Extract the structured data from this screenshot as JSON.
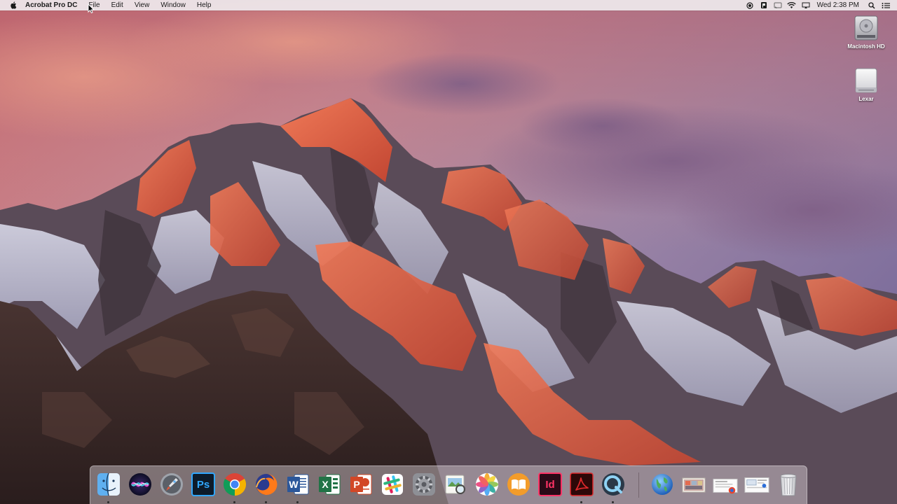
{
  "menubar": {
    "apple_icon": "apple-logo-icon",
    "app_name": "Acrobat Pro DC",
    "menus": [
      "File",
      "Edit",
      "View",
      "Window",
      "Help"
    ],
    "status_icons": [
      "record-icon",
      "flag-icon",
      "cast-icon",
      "wifi-icon",
      "airplay-icon"
    ],
    "clock": "Wed 2:38 PM",
    "search_icon": "spotlight-search-icon",
    "list_icon": "notification-center-icon"
  },
  "desktop": {
    "icons": [
      {
        "label": "Macintosh HD",
        "icon": "hard-drive-icon"
      },
      {
        "label": "Lexar",
        "icon": "external-drive-icon"
      }
    ]
  },
  "dock": {
    "apps": [
      {
        "name": "Finder",
        "icon": "finder-icon",
        "running": true
      },
      {
        "name": "Siri",
        "icon": "siri-icon",
        "running": false
      },
      {
        "name": "Launchpad",
        "icon": "launchpad-icon",
        "running": false
      },
      {
        "name": "Photoshop",
        "icon": "photoshop-icon",
        "glyph": "Ps",
        "running": false
      },
      {
        "name": "Chrome",
        "icon": "chrome-icon",
        "running": true
      },
      {
        "name": "Firefox",
        "icon": "firefox-icon",
        "running": true
      },
      {
        "name": "Word",
        "icon": "word-icon",
        "glyph": "W",
        "running": true
      },
      {
        "name": "Excel",
        "icon": "excel-icon",
        "glyph": "X",
        "running": false
      },
      {
        "name": "PowerPoint",
        "icon": "powerpoint-icon",
        "glyph": "P",
        "running": false
      },
      {
        "name": "Slack",
        "icon": "slack-icon",
        "running": false
      },
      {
        "name": "System Preferences",
        "icon": "system-preferences-icon",
        "running": false
      },
      {
        "name": "Preview",
        "icon": "preview-icon",
        "running": false
      },
      {
        "name": "Photos",
        "icon": "photos-icon",
        "running": false
      },
      {
        "name": "iBooks",
        "icon": "ibooks-icon",
        "running": false
      },
      {
        "name": "InDesign",
        "icon": "indesign-icon",
        "glyph": "Id",
        "running": false
      },
      {
        "name": "Acrobat Pro DC",
        "icon": "acrobat-icon",
        "running": true
      },
      {
        "name": "QuickTime",
        "icon": "quicktime-icon",
        "running": true
      }
    ],
    "stacks": [
      {
        "name": "Network",
        "icon": "globe-icon"
      },
      {
        "name": "Stack 1",
        "icon": "image-stack-icon"
      },
      {
        "name": "Stack 2",
        "icon": "document-stack-icon"
      },
      {
        "name": "Stack 3",
        "icon": "screenshot-stack-icon"
      },
      {
        "name": "Trash",
        "icon": "trash-icon"
      }
    ]
  },
  "colors": {
    "menubar_bg": "#eee8ec",
    "sky_top": "#c57a86",
    "sky_right": "#8f7ea8",
    "mountain_rock": "#4a3d45",
    "alpenglow": "#e0623f"
  }
}
